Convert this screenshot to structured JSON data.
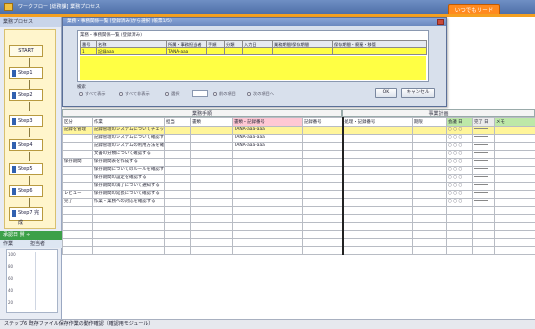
{
  "window": {
    "title": "ワークフロー [総務課] 業務プロセス",
    "anytime_button": "いつでもリード"
  },
  "left_panel": {
    "header": "業務プロセス",
    "steps": [
      "START",
      "Step1",
      "Step2",
      "Step3",
      "Step4",
      "Step5",
      "Step6",
      "Step7 完成"
    ],
    "green_label": "承認日 賛 ÷",
    "row_labels": [
      "作業",
      "担当者"
    ],
    "ticks": [
      "100",
      "80",
      "60",
      "40",
      "20",
      "0"
    ]
  },
  "dialog": {
    "title": "業務・事務関係一覧 [登録済み]から選択 (帳票1/5)",
    "inner_label": "業務・事務関係一覧 (登録済み)",
    "columns": [
      "番号",
      "名称",
      "所属・事務担当者",
      "手順",
      "分類",
      "入力日",
      "業務期間/保存期間",
      "保存期間・廃棄・移管"
    ],
    "rows": [
      {
        "no": "1",
        "name": "記録aaa",
        "owner": "TANA-aaa",
        "step": "",
        "cls": "",
        "date": "",
        "period": "",
        "keep": ""
      }
    ],
    "search_label": "検索",
    "options": [
      "すべて表示",
      "すべて非表示",
      "選択",
      "前の項目",
      "次の項目へ"
    ],
    "ok_label": "OK",
    "cancel_label": "キャンセル"
  },
  "table": {
    "group_left": "業務手順",
    "group_right": "事業計画",
    "columns": [
      "区分",
      "作業",
      "担当",
      "書類",
      "書類・記録番号",
      "記録番号",
      "処理・記録番号",
      "期限",
      "会議 日",
      "完了 日",
      "メモ"
    ],
    "rows": [
      {
        "cat": "記録を管理",
        "task": "記録管理のシステムについてチェック",
        "who": "",
        "doc": "",
        "num": "TANA-aaa-aaa",
        "rec": "",
        "proc": "",
        "due": "",
        "d1": "○ ○ ○",
        "d2": "",
        "memo": "",
        "hl": true
      },
      {
        "cat": "",
        "task": "記録管理のシステムについて確認する",
        "who": "",
        "doc": "",
        "num": "TANA-aaa-aaa",
        "rec": "",
        "proc": "",
        "due": "",
        "d1": "○ ○ ○",
        "d2": "",
        "memo": "",
        "hl": false
      },
      {
        "cat": "",
        "task": "記録管理のシステムの利用方法を確認し",
        "who": "",
        "doc": "",
        "num": "TANA-aaa-aaa",
        "rec": "",
        "proc": "",
        "due": "",
        "d1": "○ ○ ○",
        "d2": "",
        "memo": "",
        "hl": false
      },
      {
        "cat": "",
        "task": "文書の分類について確認する",
        "who": "",
        "doc": "",
        "num": "",
        "rec": "",
        "proc": "",
        "due": "",
        "d1": "○ ○ ○",
        "d2": "",
        "memo": "",
        "hl": false
      },
      {
        "cat": "保存期間",
        "task": "保存期間表を作成する",
        "who": "",
        "doc": "",
        "num": "",
        "rec": "",
        "proc": "",
        "due": "",
        "d1": "○ ○ ○",
        "d2": "",
        "memo": "",
        "hl": false
      },
      {
        "cat": "",
        "task": "保存期間についてのルールを確認する",
        "who": "",
        "doc": "",
        "num": "",
        "rec": "",
        "proc": "",
        "due": "",
        "d1": "○ ○ ○",
        "d2": "",
        "memo": "",
        "hl": false
      },
      {
        "cat": "",
        "task": "保存期間の設定を確認する",
        "who": "",
        "doc": "",
        "num": "",
        "rec": "",
        "proc": "",
        "due": "",
        "d1": "○ ○ ○",
        "d2": "",
        "memo": "",
        "hl": false
      },
      {
        "cat": "",
        "task": "保存期間の満了について通知する",
        "who": "",
        "doc": "",
        "num": "",
        "rec": "",
        "proc": "",
        "due": "",
        "d1": "○ ○ ○",
        "d2": "",
        "memo": "",
        "hl": false
      },
      {
        "cat": "レビュー",
        "task": "保存期間の延長について確認する",
        "who": "",
        "doc": "",
        "num": "",
        "rec": "",
        "proc": "",
        "due": "",
        "d1": "○ ○ ○",
        "d2": "",
        "memo": "",
        "hl": false
      },
      {
        "cat": "完了",
        "task": "作業・業務への対応を確認する",
        "who": "",
        "doc": "",
        "num": "",
        "rec": "",
        "proc": "",
        "due": "",
        "d1": "○ ○ ○",
        "d2": "",
        "memo": "",
        "hl": false
      }
    ]
  },
  "status_bar": "ステップ6 既存ファイル保存作業の動作確認（確認用モジュール）",
  "colors": {
    "accent": "#ff8a1e",
    "header": "#4f70a8",
    "highlight": "#fff59a",
    "pink": "#ffc8d4",
    "green": "#bde8a8"
  }
}
